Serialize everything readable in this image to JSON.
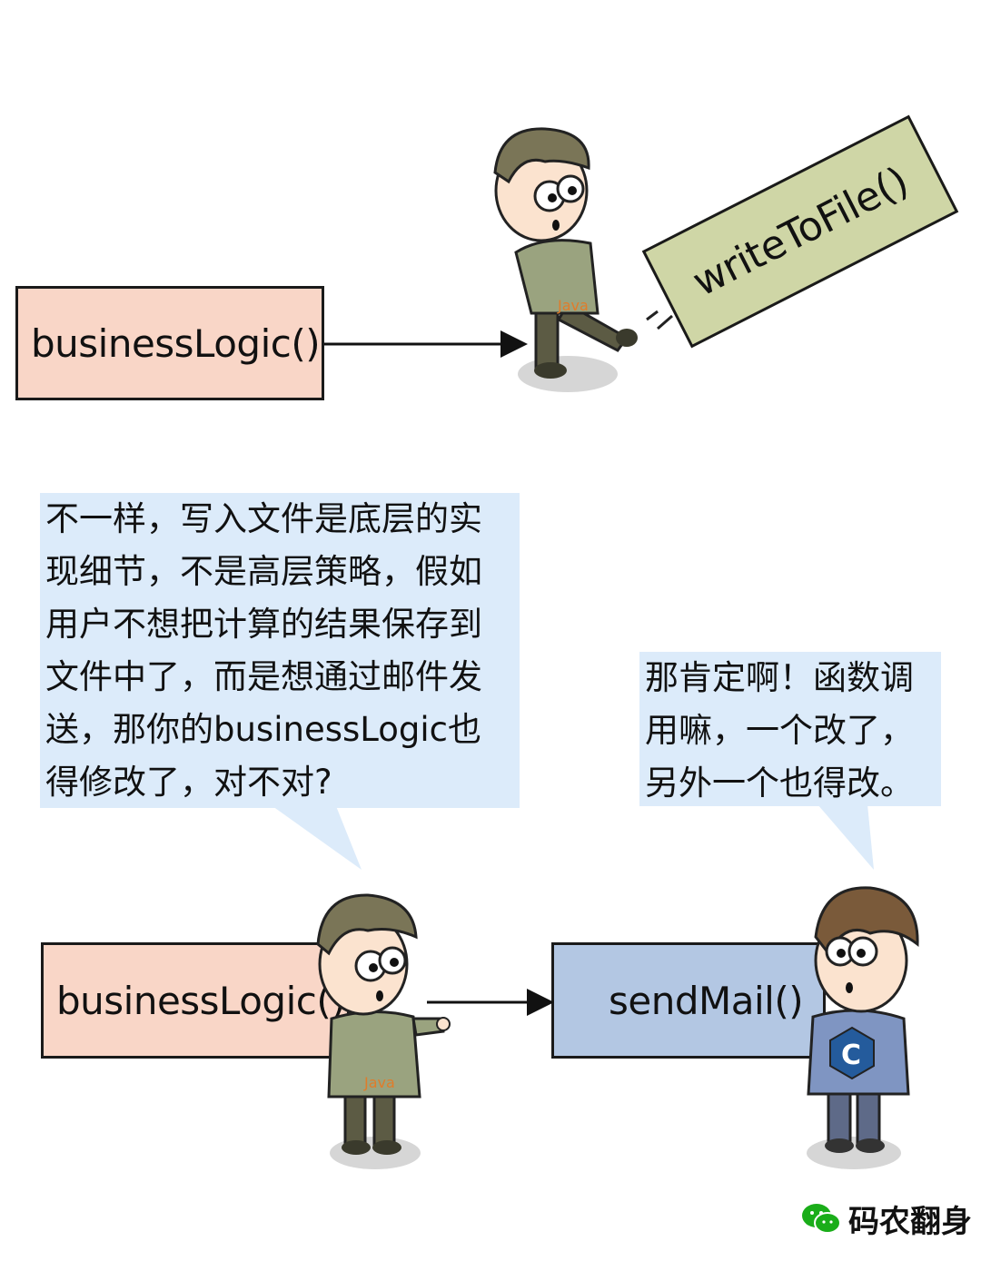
{
  "panel1": {
    "source_box": "businessLogic()",
    "kicked_box": "writeToFile()",
    "character_shirt_logo": "Java"
  },
  "panel2": {
    "speech_left": [
      "不一样，写入文件是底层的实",
      "现细节，不是高层策略，假如",
      "用户不想把计算的结果保存到",
      "文件中了，而是想通过邮件发",
      "送，那你的businessLogic也",
      "得修改了，对不对?"
    ],
    "speech_right": [
      "那肯定啊！函数调",
      "用嘛，一个改了，",
      "另外一个也得改。"
    ],
    "source_box": "businessLogic()",
    "target_box": "sendMail()",
    "java_shirt_logo": "Java",
    "c_logo": "C"
  },
  "watermark": "码农翻身",
  "colors": {
    "pink_box": "#f9d6c7",
    "green_box": "#cfd6a6",
    "blue_box": "#b3c7e3",
    "speech_bg": "#dcebfa",
    "java_shirt": "#9aa37f",
    "c_shirt": "#7f95c2"
  }
}
